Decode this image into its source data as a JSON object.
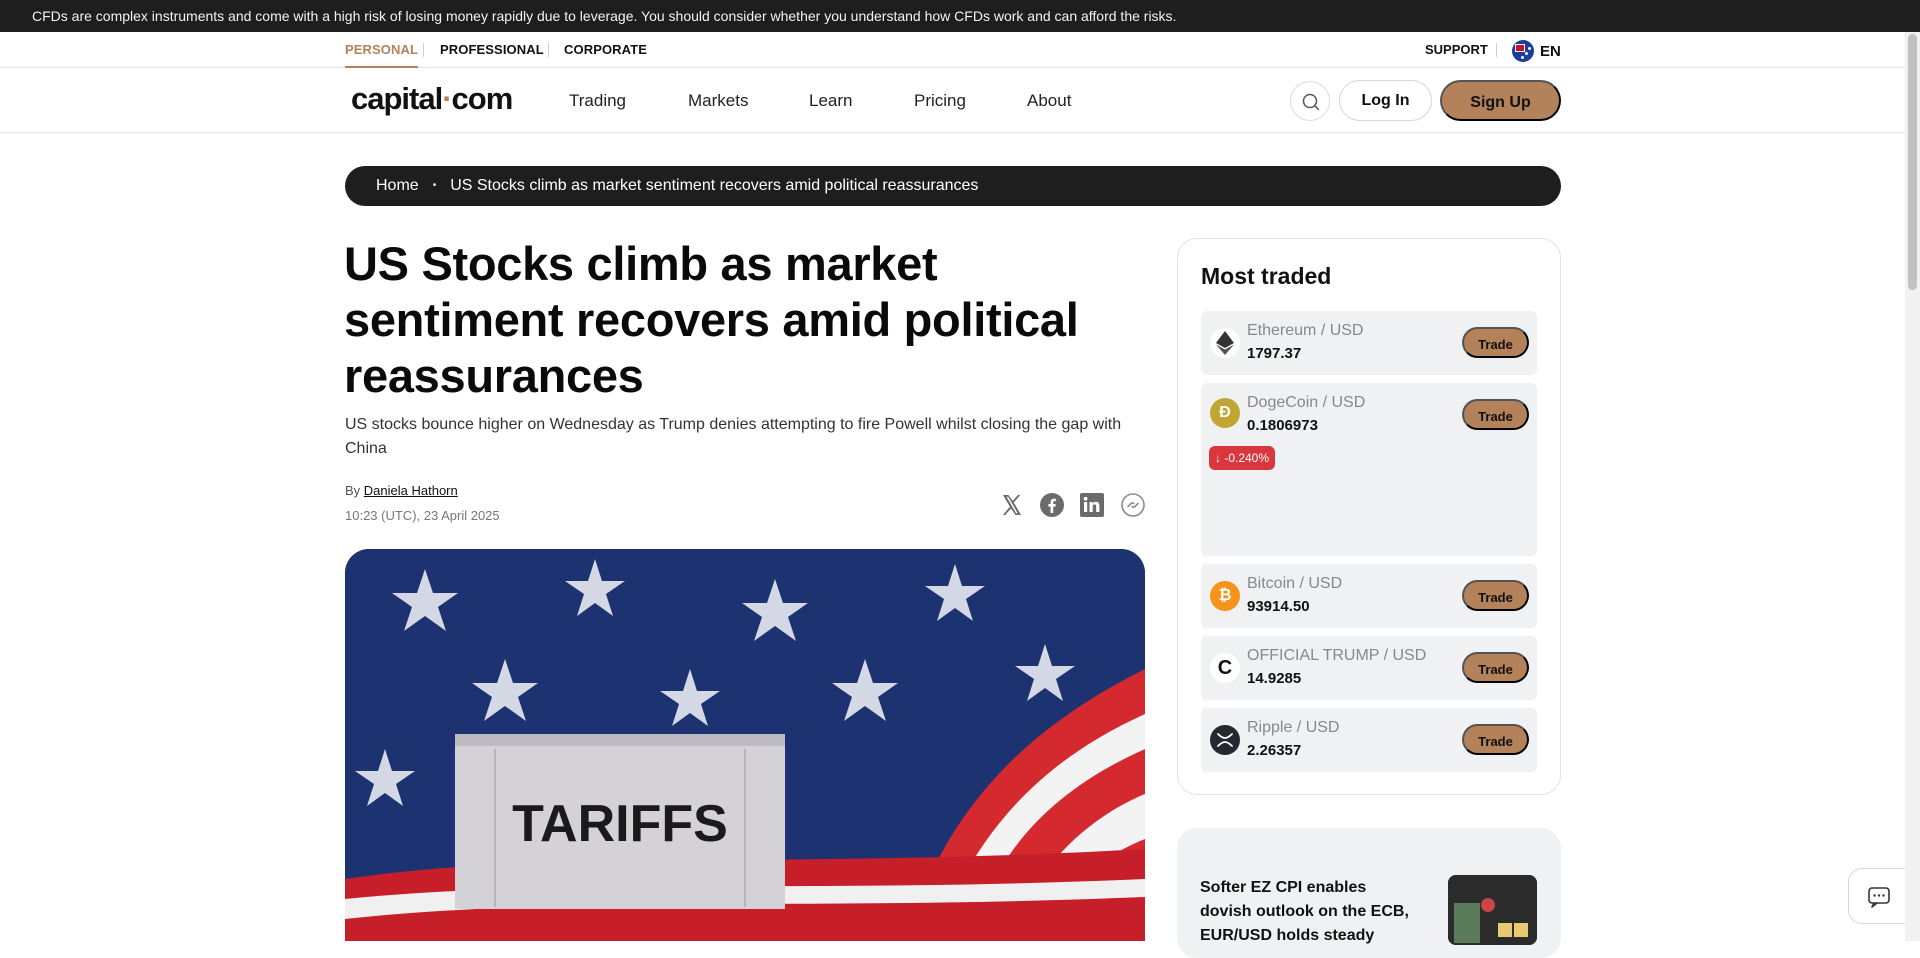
{
  "risk_warning": "CFDs are complex instruments and come with a high risk of losing money rapidly due to leverage. You should consider whether you understand how CFDs work and can afford the risks.",
  "segments": [
    "PERSONAL",
    "PROFESSIONAL",
    "CORPORATE"
  ],
  "support_label": "SUPPORT",
  "language": "EN",
  "logo": {
    "part1": "capital",
    "dot": "·",
    "part2": "com"
  },
  "nav": [
    "Trading",
    "Markets",
    "Learn",
    "Pricing",
    "About"
  ],
  "auth": {
    "login": "Log In",
    "signup": "Sign Up"
  },
  "breadcrumb": {
    "home": "Home",
    "separator": "•",
    "current": "US Stocks climb as market sentiment recovers amid political reassurances"
  },
  "article": {
    "title": "US Stocks climb as market sentiment recovers amid political reassurances",
    "subtitle": "US stocks bounce higher on Wednesday as Trump denies attempting to fire Powell whilst closing the gap with China",
    "by_prefix": "By",
    "author": "Daniela Hathorn",
    "date": "10:23 (UTC), 23 April 2025",
    "hero_text": "TARIFFS"
  },
  "most_traded": {
    "title": "Most traded",
    "items": [
      {
        "name": "Ethereum / USD",
        "price": "1797.37",
        "icon": "ethereum-icon",
        "trade": "Trade"
      },
      {
        "name": "DogeCoin / USD",
        "price": "0.1806973",
        "icon": "dogecoin-icon",
        "trade": "Trade",
        "change": "↓ -0.240%"
      },
      {
        "name": "Bitcoin / USD",
        "price": "93914.50",
        "icon": "bitcoin-icon",
        "trade": "Trade"
      },
      {
        "name": "OFFICIAL TRUMP / USD",
        "price": "14.9285",
        "icon": "trump-coin-icon",
        "trade": "Trade"
      },
      {
        "name": "Ripple / USD",
        "price": "2.26357",
        "icon": "ripple-icon",
        "trade": "Trade"
      }
    ]
  },
  "news": {
    "title": "Softer EZ CPI enables dovish outlook on the ECB, EUR/USD holds steady"
  },
  "colors": {
    "accent": "#b4825a",
    "dark": "#1e1e1e",
    "negative": "#d9363e"
  }
}
